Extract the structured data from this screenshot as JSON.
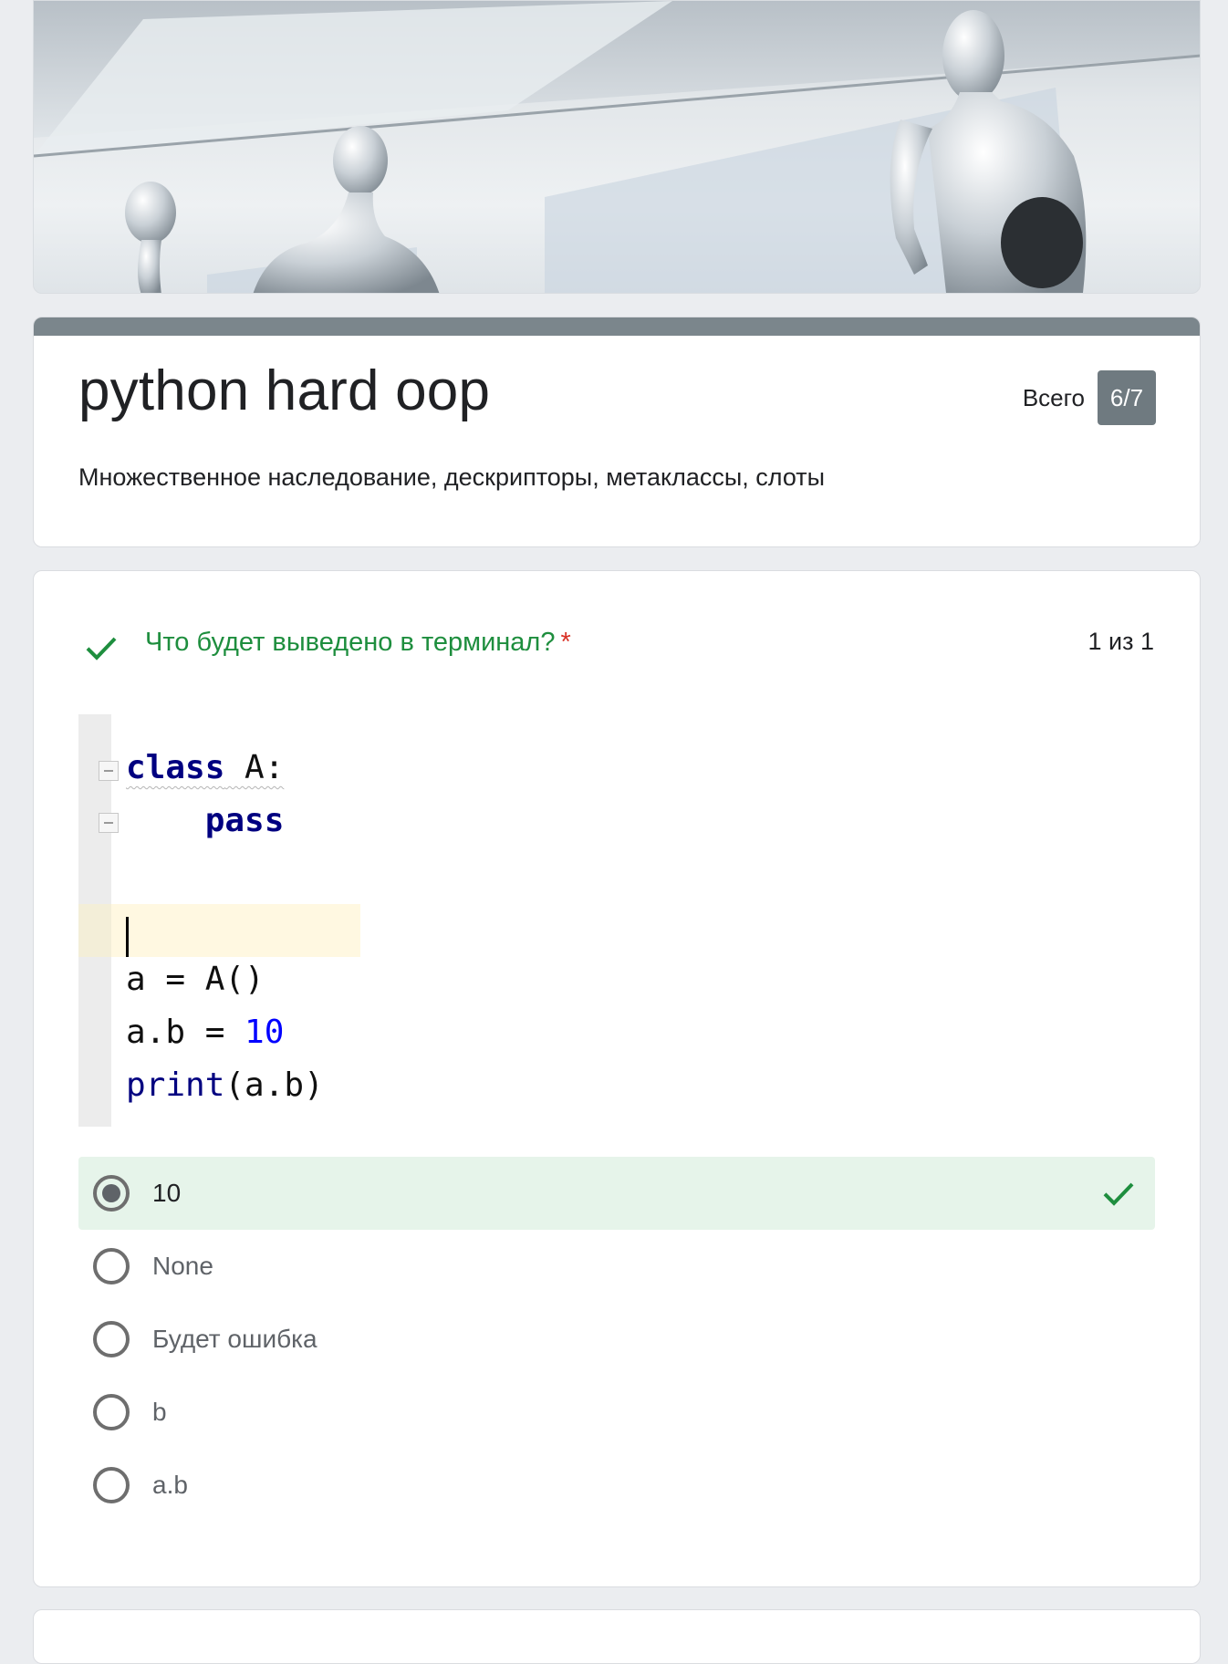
{
  "banner": {
    "image": "mannequins-classroom-banner"
  },
  "header": {
    "title": "python hard oop",
    "description": "Множественное наследование, дескрипторы, метаклассы, слоты",
    "score_label": "Всего",
    "score_value": "6/7",
    "accent_color": "#7b868c"
  },
  "question": {
    "status_icon": "check-icon",
    "title": "Что будет выведено в терминал?",
    "required_mark": "*",
    "points": "1 из 1",
    "status_color": "#1e8e3e",
    "code": {
      "line1_kw": "class",
      "line1_rest": " A:",
      "line2_indent": "    ",
      "line2_kw": "pass",
      "line4": "a = A()",
      "line5_pre": "a.b = ",
      "line5_num": "10",
      "line6_fn": "print",
      "line6_rest": "(a.b)"
    },
    "options": [
      {
        "label": "10",
        "selected": true,
        "correct": true
      },
      {
        "label": "None",
        "selected": false
      },
      {
        "label": "Будет ошибка",
        "selected": false
      },
      {
        "label": "b",
        "selected": false
      },
      {
        "label": "a.b",
        "selected": false
      }
    ]
  }
}
